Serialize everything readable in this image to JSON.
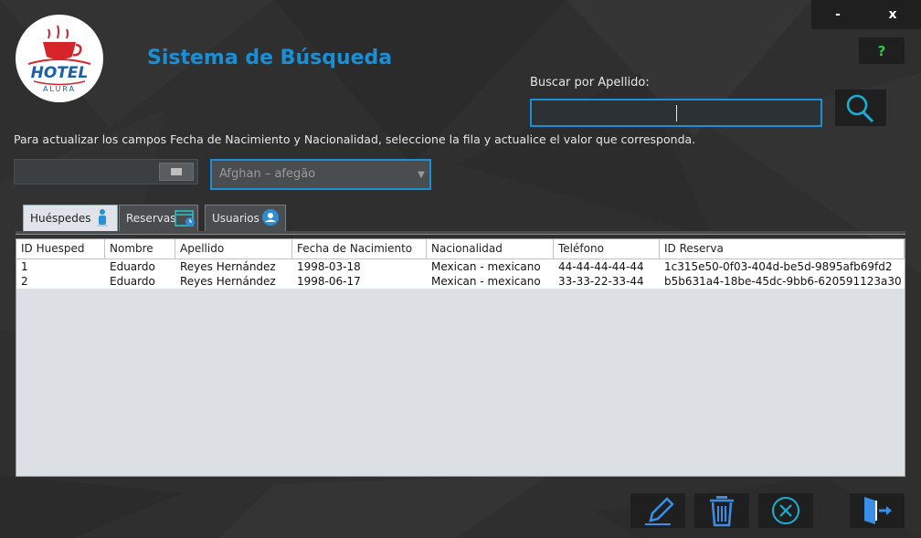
{
  "window": {
    "minimize_label": "-",
    "close_label": "x"
  },
  "help": {
    "label": "?"
  },
  "logo": {
    "brand": "HOTEL",
    "sub": "ALURA"
  },
  "title": "Sistema de Búsqueda",
  "search": {
    "label": "Buscar por Apellido:",
    "value": ""
  },
  "instructions": "Para actualizar los campos Fecha de Nacimiento y Nacionalidad, seleccione la fila y actualice el valor que corresponda.",
  "date_field": {
    "value": ""
  },
  "nationality": {
    "selected": "Afghan – afegão"
  },
  "tabs": [
    {
      "label": "Huéspedes",
      "active": true
    },
    {
      "label": "Reservas",
      "active": false
    },
    {
      "label": "Usuarios",
      "active": false
    }
  ],
  "table": {
    "columns": [
      "ID Huesped",
      "Nombre",
      "Apellido",
      "Fecha de Nacimiento",
      "Nacionalidad",
      "Teléfono",
      "ID Reserva"
    ],
    "rows": [
      [
        "1",
        "Eduardo",
        "Reyes Hernández",
        "1998-03-18",
        "Mexican - mexicano",
        "44-44-44-44-44",
        "1c315e50-0f03-404d-be5d-9895afb69fd2"
      ],
      [
        "2",
        "Eduardo",
        "Reyes Hernández",
        "1998-06-17",
        "Mexican - mexicano",
        "33-33-22-33-44",
        "b5b631a4-18be-45dc-9bb6-620591123a30"
      ]
    ]
  },
  "colors": {
    "accent": "#1a8fd6",
    "help": "#2ecc40",
    "logo_red": "#d6242b"
  },
  "icons": [
    "search-icon",
    "calendar-icon",
    "chevron-down-icon",
    "person-icon",
    "calendar-clock-icon",
    "user-circle-icon",
    "edit-icon",
    "trash-icon",
    "cancel-icon",
    "exit-icon"
  ]
}
